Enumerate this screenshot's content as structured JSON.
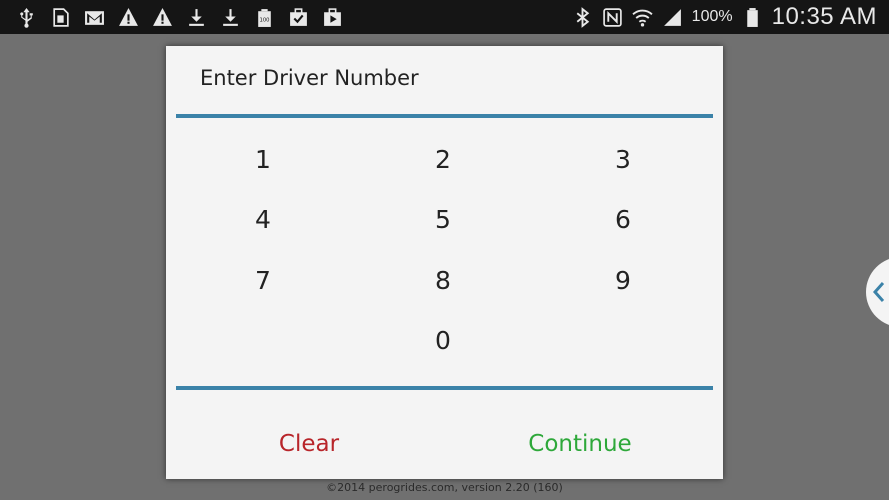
{
  "status_bar": {
    "left_icons": [
      "usb-icon",
      "sd-card-icon",
      "gmail-icon",
      "warning-icon",
      "warning-icon",
      "download-icon",
      "download-icon",
      "battery-100-icon",
      "clipboard-check-icon",
      "media-icon"
    ],
    "right_icons": [
      "bluetooth-icon",
      "nfc-icon",
      "wifi-icon",
      "signal-icon",
      "battery-icon"
    ],
    "battery": "100%",
    "time": "10:35 AM"
  },
  "dialog": {
    "title": "Enter Driver Number",
    "keys": [
      "1",
      "2",
      "3",
      "4",
      "5",
      "6",
      "7",
      "8",
      "9",
      "0"
    ],
    "clear_label": "Clear",
    "continue_label": "Continue"
  },
  "footer": {
    "text": "©2014 perogrides.com, version 2.20 (160)"
  },
  "colors": {
    "accent": "#3b82a8",
    "clear": "#b8252a",
    "continue": "#2ea83a",
    "backdrop": "#707070"
  }
}
